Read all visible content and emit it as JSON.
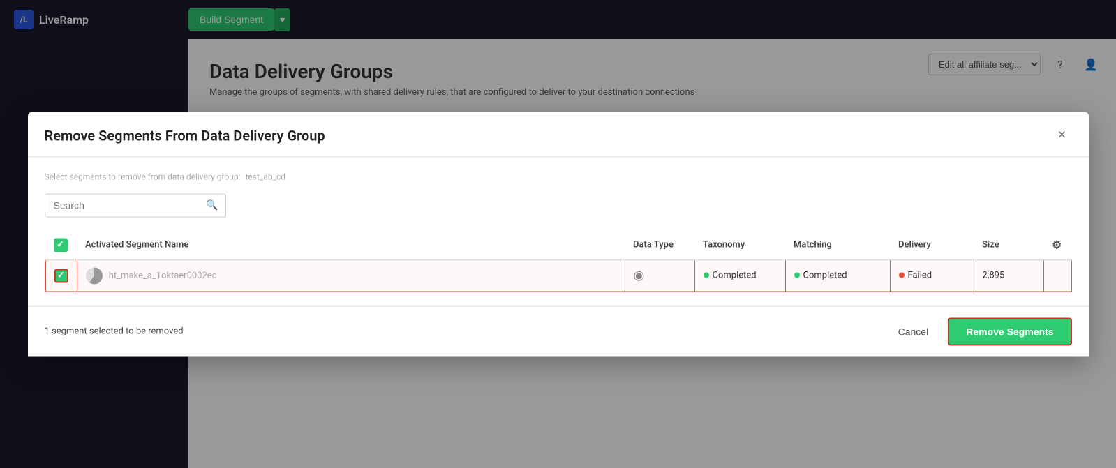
{
  "nav": {
    "logo_text": "LiveRamp",
    "logo_icon": "/L",
    "build_segment_label": "Build Segment",
    "build_arrow": "▾",
    "account_placeholder": "Edit all affiliate seg...",
    "help_icon": "?",
    "user_icon": "👤"
  },
  "page": {
    "title": "Data Delivery Groups",
    "subtitle": "Manage the groups of segments, with shared delivery rules, that are configured to deliver to your destination connections"
  },
  "modal": {
    "title": "Remove Segments From Data Delivery Group",
    "close_icon": "×",
    "select_label": "Select segments to remove from data delivery group:",
    "group_name": "test_ab_cd",
    "search": {
      "placeholder": "Search",
      "icon": "🔍"
    },
    "table": {
      "headers": {
        "name": "Activated Segment Name",
        "data_type": "Data Type",
        "taxonomy": "Taxonomy",
        "matching": "Matching",
        "delivery": "Delivery",
        "size": "Size"
      },
      "rows": [
        {
          "id": "row1",
          "selected": true,
          "name": "ht_make_a_1oktaer0002ec",
          "data_type": "shield",
          "taxonomy_status": "Completed",
          "taxonomy_color": "green",
          "matching_status": "Completed",
          "matching_color": "green",
          "delivery_status": "Failed",
          "delivery_color": "red",
          "size": "2,895"
        }
      ]
    },
    "footer": {
      "selection_info": "1 segment selected to be removed",
      "cancel_label": "Cancel",
      "remove_label": "Remove Segments"
    }
  }
}
